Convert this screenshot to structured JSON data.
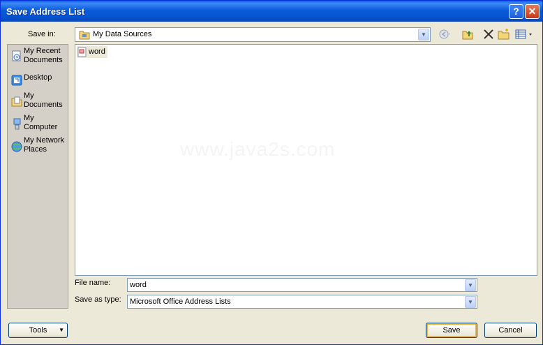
{
  "window": {
    "title": "Save Address List"
  },
  "title_buttons": {
    "help": "?",
    "close": "✕"
  },
  "save_in": {
    "label": "Save in:",
    "value": "My Data Sources",
    "icon": "folder-icon"
  },
  "toolbar": {
    "icons": [
      "back-icon",
      "up-folder-icon",
      "delete-icon",
      "new-folder-icon",
      "views-icon"
    ]
  },
  "places": [
    {
      "label": "My Recent Documents",
      "icon": "recent-documents-icon"
    },
    {
      "label": "Desktop",
      "icon": "desktop-icon"
    },
    {
      "label": "My Documents",
      "icon": "my-documents-icon"
    },
    {
      "label": "My Computer",
      "icon": "my-computer-icon"
    },
    {
      "label": "My Network Places",
      "icon": "network-places-icon"
    }
  ],
  "files": [
    {
      "name": "word",
      "icon": "address-list-file-icon"
    }
  ],
  "watermark": "www.java2s.com",
  "file_name": {
    "label": "File name:",
    "value": "word"
  },
  "save_as_type": {
    "label": "Save as type:",
    "value": "Microsoft Office Address Lists"
  },
  "buttons": {
    "tools": "Tools",
    "save": "Save",
    "cancel": "Cancel"
  }
}
